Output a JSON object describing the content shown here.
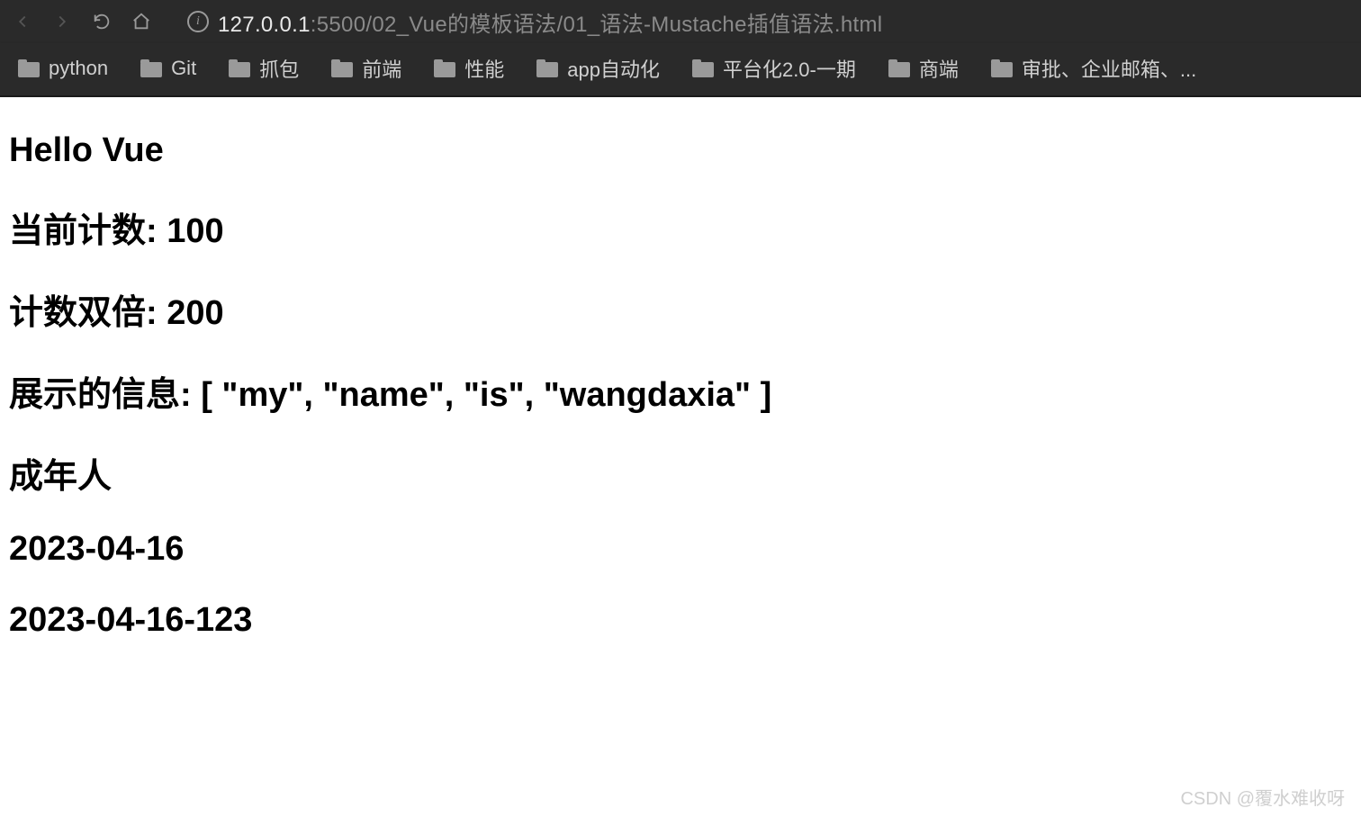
{
  "browser": {
    "url_host": "127.0.0.1",
    "url_path": ":5500/02_Vue的模板语法/01_语法-Mustache插值语法.html",
    "bookmarks": [
      "python",
      "Git",
      "抓包",
      "前端",
      "性能",
      "app自动化",
      "平台化2.0-一期",
      "商端",
      "审批、企业邮箱、..."
    ]
  },
  "page": {
    "h1": "Hello Vue",
    "h2": "当前计数: 100",
    "h3": "计数双倍: 200",
    "h4": "展示的信息: [ \"my\", \"name\", \"is\", \"wangdaxia\" ]",
    "h5": "成年人",
    "h6": "2023-04-16",
    "h7": "2023-04-16-123"
  },
  "watermark": "CSDN @覆水难收呀"
}
